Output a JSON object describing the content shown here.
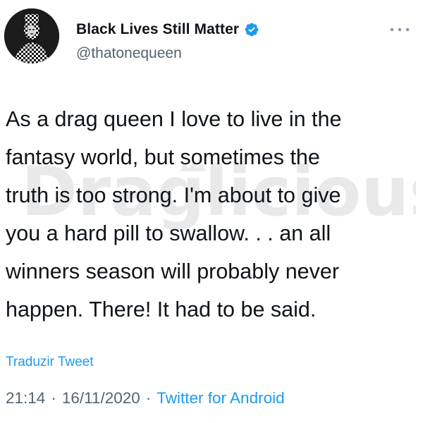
{
  "user": {
    "display_name": "Black Lives Still Matter",
    "handle": "@thatonequeen",
    "verified": true,
    "avatar_icon": "avatar-checkered-costume"
  },
  "tweet": {
    "text": "As a drag queen I love to live in the\nfantasy world, but sometimes the\ntruth is too strong. I'm about to give\nyou a hard pill to swallow. . . an all\nwinners season will probably never\nhappen. There! It had to be said.",
    "translate_label": "Traduzir Tweet",
    "time": "21:14",
    "date": "16/11/2020",
    "separator": "·",
    "source": "Twitter for Android"
  },
  "watermark": {
    "text": "Draglicious"
  },
  "icons": {
    "more": "more-horizontal-icon",
    "verified": "verified-badge-icon"
  },
  "colors": {
    "link": "#1d9bf0",
    "secondary_text": "#536471",
    "primary_text": "#0f1419",
    "verified": "#1d9bf0"
  }
}
